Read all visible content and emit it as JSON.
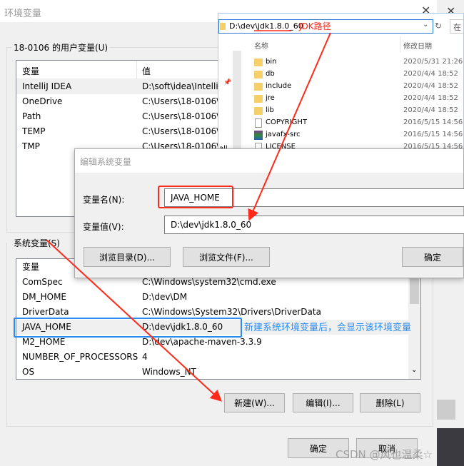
{
  "env_dialog": {
    "title": "环境变量",
    "user_group_label": "18-0106 的用户变量(U)",
    "user_columns": [
      "变量",
      "值"
    ],
    "user_vars": [
      {
        "name": "IntelliJ IDEA",
        "value": "D:\\soft\\idea\\IntelliJ"
      },
      {
        "name": "OneDrive",
        "value": "C:\\Users\\18-0106\\"
      },
      {
        "name": "Path",
        "value": "C:\\Users\\18-0106\\"
      },
      {
        "name": "TEMP",
        "value": "C:\\Users\\18-0106\\"
      },
      {
        "name": "TMP",
        "value": "C:\\Users\\18-0106\\"
      }
    ],
    "system_group_label": "系统变量(S)",
    "system_columns": [
      "变量"
    ],
    "system_vars": [
      {
        "name": "ComSpec",
        "value": "C:\\Windows\\system32\\cmd.exe"
      },
      {
        "name": "DM_HOME",
        "value": "D:\\dev\\DM"
      },
      {
        "name": "DriverData",
        "value": "C:\\Windows\\System32\\Drivers\\DriverData"
      },
      {
        "name": "JAVA_HOME",
        "value": "D:\\dev\\jdk1.8.0_60"
      },
      {
        "name": "M2_HOME",
        "value": "D:\\dev\\apache-maven-3.3.9"
      },
      {
        "name": "NUMBER_OF_PROCESSORS",
        "value": "4"
      },
      {
        "name": "OS",
        "value": "Windows_NT"
      }
    ],
    "new_button": "新建(W)...",
    "edit_button": "编辑(I)...",
    "delete_button": "删除(L)",
    "ok_button": "确定",
    "cancel_button": "取消"
  },
  "explorer": {
    "address": "D:\\dev\\jdk1.8.0_60",
    "search_placeholder": "在",
    "nav_label": "all",
    "columns": {
      "name": "名称",
      "date": "修改日期"
    },
    "files": [
      {
        "name": "bin",
        "date": "2020/5/31 21:26",
        "icon": "folder"
      },
      {
        "name": "db",
        "date": "2020/4/4 18:52",
        "icon": "folder"
      },
      {
        "name": "include",
        "date": "2020/4/4 18:52",
        "icon": "folder"
      },
      {
        "name": "jre",
        "date": "2020/4/4 18:52",
        "icon": "folder"
      },
      {
        "name": "lib",
        "date": "2020/4/4 18:52",
        "icon": "folder"
      },
      {
        "name": "COPYRIGHT",
        "date": "2016/5/15 14:56",
        "icon": "file"
      },
      {
        "name": "javafx-src",
        "date": "2016/5/15 14:56",
        "icon": "archive"
      },
      {
        "name": "LICENSE",
        "date": "2016/5/15 14:56",
        "icon": "file"
      }
    ]
  },
  "edit_dialog": {
    "title": "编辑系统变量",
    "name_label": "变量名(N):",
    "name_value": "JAVA_HOME",
    "value_label": "变量值(V):",
    "value_value": "D:\\dev\\jdk1.8.0_60",
    "browse_dir_button": "浏览目录(D)...",
    "browse_file_button": "浏览文件(F)...",
    "ok_button": "确定"
  },
  "annotations": {
    "jdk_path": "JDK路径",
    "new_var_note": "新建系统环境变量后，会显示该环境变量",
    "red": "#ff2a1a",
    "blue": "#2a8cf0"
  },
  "watermark": "CSDN @风也温柔☆"
}
